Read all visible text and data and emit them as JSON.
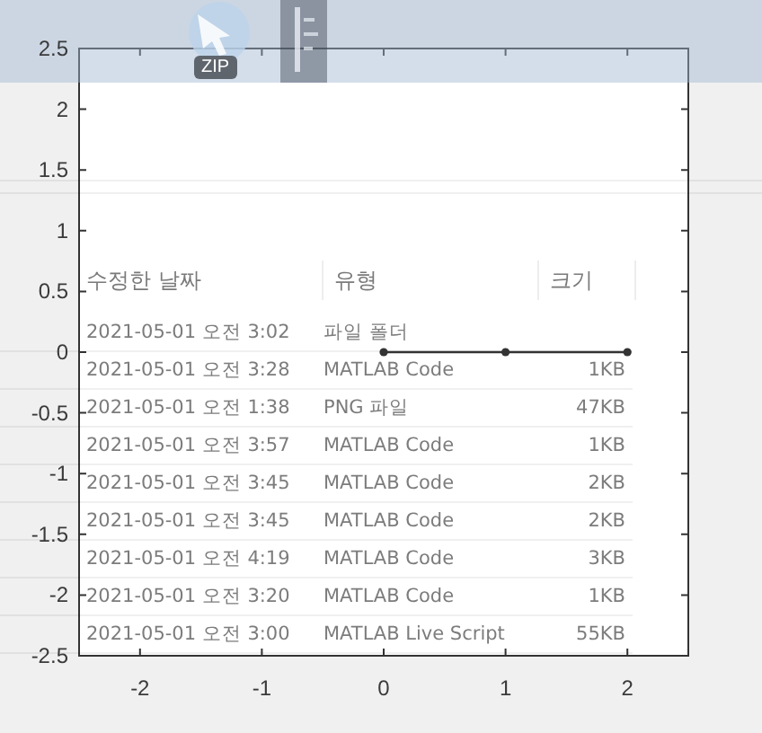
{
  "thumbnails": {
    "badge": "ZIP"
  },
  "file_list": {
    "columns": [
      "수정한 날짜",
      "유형",
      "크기"
    ],
    "rows": [
      {
        "date": "2021-05-01 오전 3:02",
        "type": "파일 폴더"
      },
      {
        "date": "2021-05-01 오전 3:28",
        "type": "MATLAB Code",
        "size": "1KB"
      },
      {
        "date": "2021-05-01 오전 1:38",
        "type": "PNG 파일",
        "size": "47KB"
      },
      {
        "date": "2021-05-01 오전 3:57",
        "type": "MATLAB Code",
        "size": "1KB"
      },
      {
        "date": "2021-05-01 오전 3:45",
        "type": "MATLAB Code",
        "size": "2KB"
      },
      {
        "date": "2021-05-01 오전 3:45",
        "type": "MATLAB Code",
        "size": "2KB"
      },
      {
        "date": "2021-05-01 오전 4:19",
        "type": "MATLAB Code",
        "size": "3KB"
      },
      {
        "date": "2021-05-01 오전 3:20",
        "type": "MATLAB Code",
        "size": "1KB"
      },
      {
        "date": "2021-05-01 오전 3:00",
        "type": "MATLAB Live Script",
        "size": "55KB"
      }
    ]
  },
  "figure": {
    "chart_data": {
      "type": "line",
      "x": [
        0,
        1,
        2
      ],
      "series": [
        {
          "color": "#333333",
          "marker": "o",
          "values": [
            0,
            0,
            0
          ]
        }
      ],
      "xlim": [
        -2.5,
        2.5
      ],
      "ylim": [
        -2.5,
        2.5
      ],
      "xticks": [
        -2,
        -1,
        0,
        1,
        2
      ],
      "yticks": [
        -2.5,
        -2,
        -1.5,
        -1,
        -0.5,
        0,
        0.5,
        1,
        1.5,
        2,
        2.5
      ]
    }
  }
}
